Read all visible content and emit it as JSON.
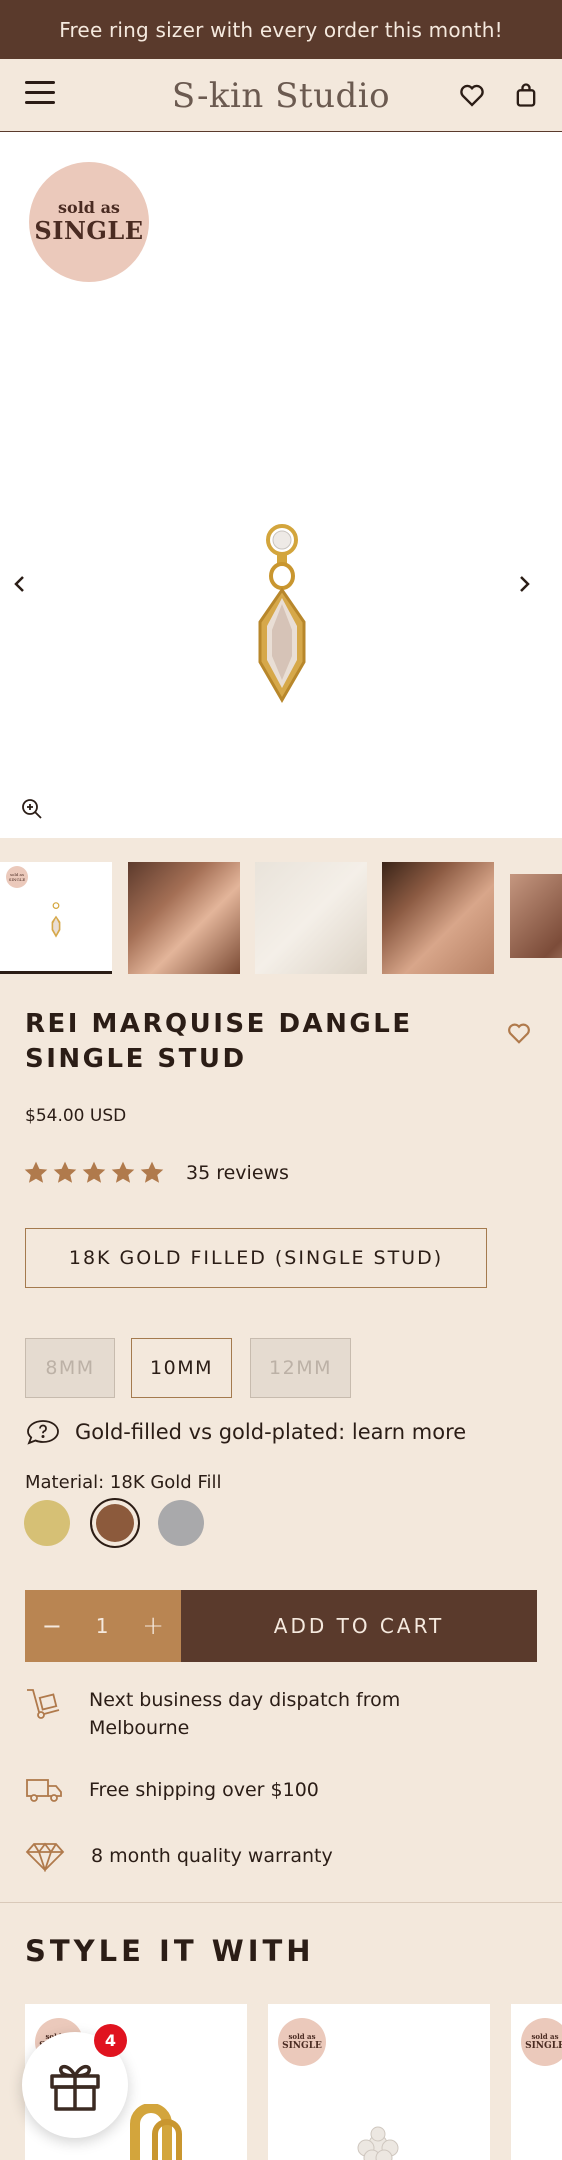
{
  "announcement": "Free ring sizer with every order this month!",
  "header": {
    "logo": "S-kin Studio",
    "icons": [
      "menu-icon",
      "heart-icon",
      "bag-icon"
    ]
  },
  "gallery": {
    "badge_line1": "sold as",
    "badge_line2": "SINGLE",
    "thumb_badge": "sold as SINGLE",
    "icons": [
      "chevron-left-icon",
      "chevron-right-icon",
      "zoom-in-icon"
    ]
  },
  "product": {
    "title": "REI MARQUISE DANGLE SINGLE STUD",
    "price": "$54.00 USD",
    "rating": 5,
    "reviews": "35 reviews",
    "variant": "18K GOLD FILLED (SINGLE STUD)",
    "sizes": [
      {
        "label": "8MM",
        "state": "unavailable"
      },
      {
        "label": "10MM",
        "state": "selected"
      },
      {
        "label": "12MM",
        "state": "unavailable"
      }
    ],
    "learn_more": "Gold-filled vs gold-plated: learn more",
    "material_label": "Material: 18K Gold Fill",
    "swatches": [
      {
        "name": "gold",
        "color": "#d6c075"
      },
      {
        "name": "rose-bronze",
        "color": "#8c5a3c",
        "selected": true
      },
      {
        "name": "silver",
        "color": "#a9a9ab"
      }
    ],
    "quantity": "1",
    "minus": "−",
    "plus": "+",
    "add_to_cart": "ADD TO CART"
  },
  "perks": [
    {
      "icon": "dolly-icon",
      "text": "Next business day dispatch from Melbourne"
    },
    {
      "icon": "truck-icon",
      "text": "Free shipping over $100"
    },
    {
      "icon": "diamond-icon",
      "text": "8 month quality warranty"
    }
  ],
  "style_it_with": {
    "title": "STYLE IT WITH",
    "badge_line1": "sold as",
    "badge_line2": "SINGLE"
  },
  "gift": {
    "count": "4"
  },
  "colors": {
    "announcement_bg": "#5a3a2c",
    "page_bg": "#f3e8dc",
    "accent_tan": "#b98552",
    "button_dark": "#5a3a2c",
    "star": "#b07a4c",
    "badge_pink": "#ebc9bb"
  }
}
